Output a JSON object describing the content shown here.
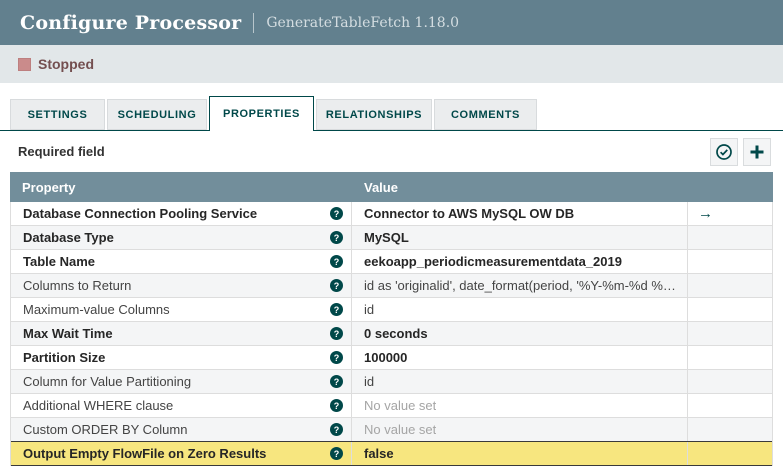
{
  "header": {
    "title": "Configure Processor",
    "subtitle": "GenerateTableFetch 1.18.0"
  },
  "status": {
    "label": "Stopped",
    "state_color": "#ca8b8b",
    "text_color": "#744f50"
  },
  "tabs": [
    {
      "label": "SETTINGS",
      "active": false
    },
    {
      "label": "SCHEDULING",
      "active": false
    },
    {
      "label": "PROPERTIES",
      "active": true
    },
    {
      "label": "RELATIONSHIPS",
      "active": false
    },
    {
      "label": "COMMENTS",
      "active": false
    }
  ],
  "toolbar": {
    "required_label": "Required field"
  },
  "icons": {
    "help_glyph": "?",
    "goto_glyph": "→",
    "verify_name": "verify-properties-icon",
    "add_name": "add-property-icon"
  },
  "table": {
    "columns": {
      "property": "Property",
      "value": "Value",
      "actions": ""
    },
    "rows": [
      {
        "property": "Database Connection Pooling Service",
        "value": "Connector to AWS MySQL OW DB",
        "required": true,
        "value_set": true,
        "goto": true,
        "selected": false
      },
      {
        "property": "Database Type",
        "value": "MySQL",
        "required": true,
        "value_set": true,
        "goto": false,
        "selected": false
      },
      {
        "property": "Table Name",
        "value": "eekoapp_periodicmeasurementdata_2019",
        "required": true,
        "value_set": true,
        "goto": false,
        "selected": false
      },
      {
        "property": "Columns to Return",
        "value": "id as 'originalid', date_format(period, '%Y-%m-%d %H:%i:%s'…",
        "required": false,
        "value_set": true,
        "goto": false,
        "selected": false
      },
      {
        "property": "Maximum-value Columns",
        "value": "id",
        "required": false,
        "value_set": true,
        "goto": false,
        "selected": false
      },
      {
        "property": "Max Wait Time",
        "value": "0 seconds",
        "required": true,
        "value_set": true,
        "goto": false,
        "selected": false
      },
      {
        "property": "Partition Size",
        "value": "100000",
        "required": true,
        "value_set": true,
        "goto": false,
        "selected": false
      },
      {
        "property": "Column for Value Partitioning",
        "value": "id",
        "required": false,
        "value_set": true,
        "goto": false,
        "selected": false
      },
      {
        "property": "Additional WHERE clause",
        "value": "No value set",
        "required": false,
        "value_set": false,
        "goto": false,
        "selected": false
      },
      {
        "property": "Custom ORDER BY Column",
        "value": "No value set",
        "required": false,
        "value_set": false,
        "goto": false,
        "selected": false
      },
      {
        "property": "Output Empty FlowFile on Zero Results",
        "value": "false",
        "required": true,
        "value_set": true,
        "goto": false,
        "selected": true
      }
    ]
  },
  "colors": {
    "header_bg": "#62808e",
    "table_header_bg": "#728e9b",
    "accent_teal": "#004849",
    "status_bar_bg": "#e2e7e9",
    "selected_row_bg": "#f7e67f",
    "alt_row_bg": "#f4f5f6"
  }
}
